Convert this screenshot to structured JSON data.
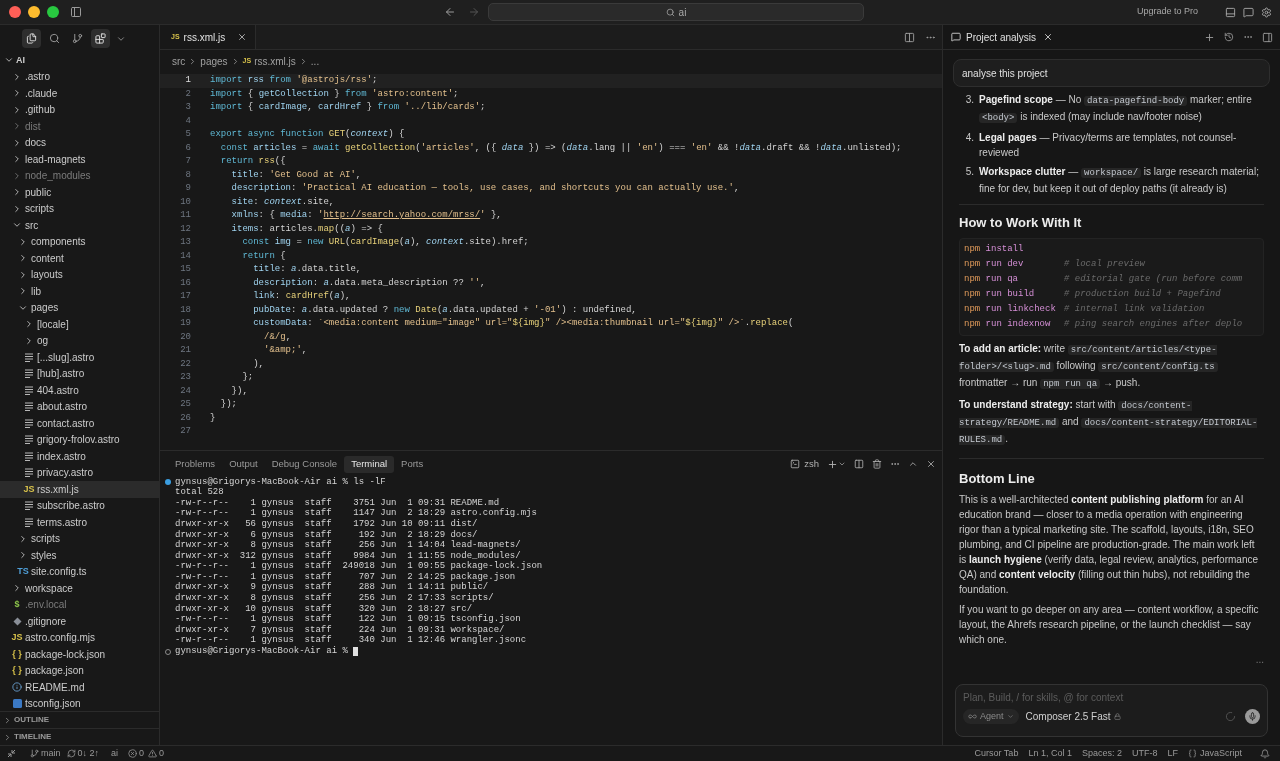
{
  "titlebar": {
    "search": "ai",
    "upgrade": "Upgrade to Pro"
  },
  "activity": [
    {
      "kind": "files",
      "selected": true
    },
    {
      "kind": "search",
      "selected": false
    },
    {
      "kind": "git",
      "selected": false
    },
    {
      "kind": "extensions",
      "selected": true
    }
  ],
  "sidebar": {
    "root": {
      "name": "AI",
      "expanded": true,
      "children": [
        {
          "name": ".astro",
          "kind": "folder",
          "expanded": false,
          "ignored": false,
          "selected": false
        },
        {
          "name": ".claude",
          "kind": "folder",
          "expanded": false,
          "ignored": false,
          "selected": false
        },
        {
          "name": ".github",
          "kind": "folder",
          "expanded": false,
          "ignored": false,
          "selected": false
        },
        {
          "name": "dist",
          "kind": "folder",
          "expanded": false,
          "ignored": true,
          "selected": false
        },
        {
          "name": "docs",
          "kind": "folder",
          "expanded": false,
          "ignored": false,
          "selected": false
        },
        {
          "name": "lead-magnets",
          "kind": "folder",
          "expanded": false,
          "ignored": false,
          "selected": false
        },
        {
          "name": "node_modules",
          "kind": "folder",
          "expanded": false,
          "ignored": true,
          "selected": false
        },
        {
          "name": "public",
          "kind": "folder",
          "expanded": false,
          "ignored": false,
          "selected": false
        },
        {
          "name": "scripts",
          "kind": "folder",
          "expanded": false,
          "ignored": false,
          "selected": false
        },
        {
          "name": "src",
          "kind": "folder",
          "expanded": true,
          "ignored": false,
          "selected": false,
          "children": [
            {
              "name": "components",
              "kind": "folder",
              "expanded": false,
              "ignored": false,
              "selected": false
            },
            {
              "name": "content",
              "kind": "folder",
              "expanded": false,
              "ignored": false,
              "selected": false
            },
            {
              "name": "layouts",
              "kind": "folder",
              "expanded": false,
              "ignored": false,
              "selected": false
            },
            {
              "name": "lib",
              "kind": "folder",
              "expanded": false,
              "ignored": false,
              "selected": false
            },
            {
              "name": "pages",
              "kind": "folder",
              "expanded": true,
              "ignored": false,
              "selected": false,
              "children": [
                {
                  "name": "[locale]",
                  "kind": "folder",
                  "expanded": false,
                  "ignored": false,
                  "selected": false
                },
                {
                  "name": "og",
                  "kind": "folder",
                  "expanded": false,
                  "ignored": false,
                  "selected": false
                },
                {
                  "name": "[...slug].astro",
                  "kind": "page",
                  "ignored": false,
                  "selected": false
                },
                {
                  "name": "[hub].astro",
                  "kind": "page",
                  "ignored": false,
                  "selected": false
                },
                {
                  "name": "404.astro",
                  "kind": "page",
                  "ignored": false,
                  "selected": false
                },
                {
                  "name": "about.astro",
                  "kind": "page",
                  "ignored": false,
                  "selected": false
                },
                {
                  "name": "contact.astro",
                  "kind": "page",
                  "ignored": false,
                  "selected": false
                },
                {
                  "name": "grigory-frolov.astro",
                  "kind": "page",
                  "ignored": false,
                  "selected": false
                },
                {
                  "name": "index.astro",
                  "kind": "page",
                  "ignored": false,
                  "selected": false
                },
                {
                  "name": "privacy.astro",
                  "kind": "page",
                  "ignored": false,
                  "selected": false
                },
                {
                  "name": "rss.xml.js",
                  "kind": "labeled",
                  "badge": "JS",
                  "color": "#d7c14a",
                  "ignored": false,
                  "selected": true
                },
                {
                  "name": "subscribe.astro",
                  "kind": "page",
                  "ignored": false,
                  "selected": false
                },
                {
                  "name": "terms.astro",
                  "kind": "page",
                  "ignored": false,
                  "selected": false
                }
              ]
            },
            {
              "name": "scripts",
              "kind": "folder",
              "expanded": false,
              "ignored": false,
              "selected": false
            },
            {
              "name": "styles",
              "kind": "folder",
              "expanded": false,
              "ignored": false,
              "selected": false
            },
            {
              "name": "site.config.ts",
              "kind": "labeled",
              "badge": "TS",
              "color": "#4f9fd8",
              "ignored": false,
              "selected": false
            }
          ]
        },
        {
          "name": "workspace",
          "kind": "folder",
          "expanded": false,
          "ignored": false,
          "selected": false
        },
        {
          "name": ".env.local",
          "kind": "labeled",
          "badge": "$",
          "color": "#8bc34a",
          "ignored": true,
          "selected": false
        },
        {
          "name": ".gitignore",
          "kind": "ignorefile",
          "ignored": false,
          "selected": false
        },
        {
          "name": "astro.config.mjs",
          "kind": "labeled",
          "badge": "JS",
          "color": "#d7c14a",
          "ignored": false,
          "selected": false
        },
        {
          "name": "package-lock.json",
          "kind": "labeled",
          "badge": "{ }",
          "color": "#d7c14a",
          "ignored": false,
          "selected": false
        },
        {
          "name": "package.json",
          "kind": "labeled",
          "badge": "{ }",
          "color": "#d7c14a",
          "ignored": false,
          "selected": false
        },
        {
          "name": "README.md",
          "kind": "readme",
          "ignored": false,
          "selected": false
        },
        {
          "name": "tsconfig.json",
          "kind": "config",
          "ignored": false,
          "selected": false
        }
      ]
    },
    "sections": [
      "OUTLINE",
      "TIMELINE"
    ]
  },
  "editor": {
    "tab": {
      "badge": "JS",
      "name": "rss.xml.js"
    },
    "breadcrumb": [
      "src",
      "pages",
      "rss.xml.js",
      "..."
    ],
    "breadcrumb_badge": "JS",
    "lines": [
      {
        "number": "1",
        "current": true,
        "tokens": [
          {
            "kind": "k",
            "text": "import "
          },
          {
            "kind": "p",
            "text": "rss "
          },
          {
            "kind": "k",
            "text": "from "
          },
          {
            "kind": "s",
            "text": "'@astrojs/rss'"
          },
          {
            "kind": "o",
            "text": ";"
          }
        ]
      },
      {
        "number": "2",
        "current": false,
        "tokens": [
          {
            "kind": "k",
            "text": "import "
          },
          {
            "kind": "o",
            "text": "{ "
          },
          {
            "kind": "p",
            "text": "getCollection "
          },
          {
            "kind": "o",
            "text": "} "
          },
          {
            "kind": "k",
            "text": "from "
          },
          {
            "kind": "s",
            "text": "'astro:content'"
          },
          {
            "kind": "o",
            "text": ";"
          }
        ]
      },
      {
        "number": "3",
        "current": false,
        "tokens": [
          {
            "kind": "k",
            "text": "import "
          },
          {
            "kind": "o",
            "text": "{ "
          },
          {
            "kind": "p",
            "text": "cardImage"
          },
          {
            "kind": "o",
            "text": ", "
          },
          {
            "kind": "p",
            "text": "cardHref "
          },
          {
            "kind": "o",
            "text": "} "
          },
          {
            "kind": "k",
            "text": "from "
          },
          {
            "kind": "s",
            "text": "'../lib/cards'"
          },
          {
            "kind": "o",
            "text": ";"
          }
        ]
      },
      {
        "number": "4",
        "current": false
      },
      {
        "number": "5",
        "current": false,
        "tokens": [
          {
            "kind": "k",
            "text": "export async function "
          },
          {
            "kind": "f",
            "text": "GET"
          },
          {
            "kind": "o",
            "text": "("
          },
          {
            "kind": "v",
            "text": "context"
          },
          {
            "kind": "o",
            "text": ") {"
          }
        ]
      },
      {
        "number": "6",
        "current": false,
        "tokens": [
          {
            "kind": "k",
            "text": "  const "
          },
          {
            "kind": "p",
            "text": "articles "
          },
          {
            "kind": "o",
            "text": "= "
          },
          {
            "kind": "k",
            "text": "await "
          },
          {
            "kind": "f",
            "text": "getCollection"
          },
          {
            "kind": "o",
            "text": "("
          },
          {
            "kind": "s",
            "text": "'articles'"
          },
          {
            "kind": "o",
            "text": ", ({ "
          },
          {
            "kind": "v",
            "text": "data"
          },
          {
            "kind": "o",
            "text": " }) => ("
          },
          {
            "kind": "v",
            "text": "data"
          },
          {
            "kind": "o",
            "text": ".lang || "
          },
          {
            "kind": "s",
            "text": "'en'"
          },
          {
            "kind": "o",
            "text": ") === "
          },
          {
            "kind": "s",
            "text": "'en'"
          },
          {
            "kind": "o",
            "text": " && !"
          },
          {
            "kind": "v",
            "text": "data"
          },
          {
            "kind": "o",
            "text": ".draft && !"
          },
          {
            "kind": "v",
            "text": "data"
          },
          {
            "kind": "o",
            "text": ".unlisted);"
          }
        ]
      },
      {
        "number": "7",
        "current": false,
        "tokens": [
          {
            "kind": "k",
            "text": "  return "
          },
          {
            "kind": "f",
            "text": "rss"
          },
          {
            "kind": "o",
            "text": "({"
          }
        ]
      },
      {
        "number": "8",
        "current": false,
        "tokens": [
          {
            "kind": "p",
            "text": "    title"
          },
          {
            "kind": "o",
            "text": ": "
          },
          {
            "kind": "s",
            "text": "'Get Good at AI'"
          },
          {
            "kind": "o",
            "text": ","
          }
        ]
      },
      {
        "number": "9",
        "current": false,
        "tokens": [
          {
            "kind": "p",
            "text": "    description"
          },
          {
            "kind": "o",
            "text": ": "
          },
          {
            "kind": "s",
            "text": "'Practical AI education — tools, use cases, and shortcuts you can actually use.'"
          },
          {
            "kind": "o",
            "text": ","
          }
        ]
      },
      {
        "number": "10",
        "current": false,
        "tokens": [
          {
            "kind": "p",
            "text": "    site"
          },
          {
            "kind": "o",
            "text": ": "
          },
          {
            "kind": "v",
            "text": "context"
          },
          {
            "kind": "o",
            "text": ".site,"
          }
        ]
      },
      {
        "number": "11",
        "current": false,
        "tokens": [
          {
            "kind": "p",
            "text": "    xmlns"
          },
          {
            "kind": "o",
            "text": ": { "
          },
          {
            "kind": "p",
            "text": "media"
          },
          {
            "kind": "o",
            "text": ": "
          },
          {
            "kind": "s",
            "text": "'"
          },
          {
            "kind": "u",
            "text": "http://search.yahoo.com/mrss/"
          },
          {
            "kind": "s",
            "text": "'"
          },
          {
            "kind": "o",
            "text": " },"
          }
        ]
      },
      {
        "number": "12",
        "current": false,
        "tokens": [
          {
            "kind": "p",
            "text": "    items"
          },
          {
            "kind": "o",
            "text": ": articles."
          },
          {
            "kind": "f",
            "text": "map"
          },
          {
            "kind": "o",
            "text": "(("
          },
          {
            "kind": "v",
            "text": "a"
          },
          {
            "kind": "o",
            "text": ") => {"
          }
        ]
      },
      {
        "number": "13",
        "current": false,
        "tokens": [
          {
            "kind": "k",
            "text": "      const "
          },
          {
            "kind": "p",
            "text": "img "
          },
          {
            "kind": "o",
            "text": "= "
          },
          {
            "kind": "k",
            "text": "new "
          },
          {
            "kind": "f",
            "text": "URL"
          },
          {
            "kind": "o",
            "text": "("
          },
          {
            "kind": "f",
            "text": "cardImage"
          },
          {
            "kind": "o",
            "text": "("
          },
          {
            "kind": "v",
            "text": "a"
          },
          {
            "kind": "o",
            "text": "), "
          },
          {
            "kind": "v",
            "text": "context"
          },
          {
            "kind": "o",
            "text": ".site).href;"
          }
        ]
      },
      {
        "number": "14",
        "current": false,
        "tokens": [
          {
            "kind": "k",
            "text": "      return "
          },
          {
            "kind": "o",
            "text": "{"
          }
        ]
      },
      {
        "number": "15",
        "current": false,
        "tokens": [
          {
            "kind": "p",
            "text": "        title"
          },
          {
            "kind": "o",
            "text": ": "
          },
          {
            "kind": "v",
            "text": "a"
          },
          {
            "kind": "o",
            "text": ".data.title,"
          }
        ]
      },
      {
        "number": "16",
        "current": false,
        "tokens": [
          {
            "kind": "p",
            "text": "        description"
          },
          {
            "kind": "o",
            "text": ": "
          },
          {
            "kind": "v",
            "text": "a"
          },
          {
            "kind": "o",
            "text": ".data.meta_description ?? "
          },
          {
            "kind": "s",
            "text": "''"
          },
          {
            "kind": "o",
            "text": ","
          }
        ]
      },
      {
        "number": "17",
        "current": false,
        "tokens": [
          {
            "kind": "p",
            "text": "        link"
          },
          {
            "kind": "o",
            "text": ": "
          },
          {
            "kind": "f",
            "text": "cardHref"
          },
          {
            "kind": "o",
            "text": "("
          },
          {
            "kind": "v",
            "text": "a"
          },
          {
            "kind": "o",
            "text": "),"
          }
        ]
      },
      {
        "number": "18",
        "current": false,
        "tokens": [
          {
            "kind": "p",
            "text": "        pubDate"
          },
          {
            "kind": "o",
            "text": ": "
          },
          {
            "kind": "v",
            "text": "a"
          },
          {
            "kind": "o",
            "text": ".data.updated ? "
          },
          {
            "kind": "k",
            "text": "new "
          },
          {
            "kind": "f",
            "text": "Date"
          },
          {
            "kind": "o",
            "text": "("
          },
          {
            "kind": "v",
            "text": "a"
          },
          {
            "kind": "o",
            "text": ".data.updated + "
          },
          {
            "kind": "s",
            "text": "'-01'"
          },
          {
            "kind": "o",
            "text": ") : undefined,"
          }
        ]
      },
      {
        "number": "19",
        "current": false,
        "tokens": [
          {
            "kind": "p",
            "text": "        customData"
          },
          {
            "kind": "o",
            "text": ": "
          },
          {
            "kind": "s",
            "text": "`<media:content medium=\"image\" url=\""
          },
          {
            "kind": "f",
            "text": "${img}"
          },
          {
            "kind": "s",
            "text": "\" /><media:thumbnail url=\""
          },
          {
            "kind": "f",
            "text": "${img}"
          },
          {
            "kind": "s",
            "text": "\" />`"
          },
          {
            "kind": "o",
            "text": "."
          },
          {
            "kind": "f",
            "text": "replace"
          },
          {
            "kind": "o",
            "text": "("
          }
        ]
      },
      {
        "number": "20",
        "current": false,
        "tokens": [
          {
            "kind": "s",
            "text": "          /&/g"
          },
          {
            "kind": "o",
            "text": ","
          }
        ]
      },
      {
        "number": "21",
        "current": false,
        "tokens": [
          {
            "kind": "s",
            "text": "          '&amp;'"
          },
          {
            "kind": "o",
            "text": ","
          }
        ]
      },
      {
        "number": "22",
        "current": false,
        "tokens": [
          {
            "kind": "o",
            "text": "        ),"
          }
        ]
      },
      {
        "number": "23",
        "current": false,
        "tokens": [
          {
            "kind": "o",
            "text": "      };"
          }
        ]
      },
      {
        "number": "24",
        "current": false,
        "tokens": [
          {
            "kind": "o",
            "text": "    }),"
          }
        ]
      },
      {
        "number": "25",
        "current": false,
        "tokens": [
          {
            "kind": "o",
            "text": "  });"
          }
        ]
      },
      {
        "number": "26",
        "current": false,
        "tokens": [
          {
            "kind": "o",
            "text": "}"
          }
        ]
      },
      {
        "number": "27",
        "current": false
      }
    ]
  },
  "panel": {
    "tabs": [
      {
        "label": "Problems",
        "selected": false
      },
      {
        "label": "Output",
        "selected": false
      },
      {
        "label": "Debug Console",
        "selected": false
      },
      {
        "label": "Terminal",
        "selected": true
      },
      {
        "label": "Ports",
        "selected": false
      }
    ],
    "shell": "zsh",
    "lines": [
      {
        "kind": "command",
        "text": "gynsus@Grigorys-MacBook-Air ai % ls -lF"
      },
      {
        "kind": "output",
        "text": "total 528"
      },
      {
        "kind": "output",
        "text": "-rw-r--r--    1 gynsus  staff    3751 Jun  1 09:31 README.md"
      },
      {
        "kind": "output",
        "text": "-rw-r--r--    1 gynsus  staff    1147 Jun  2 18:29 astro.config.mjs"
      },
      {
        "kind": "output",
        "text": "drwxr-xr-x   56 gynsus  staff    1792 Jun 10 09:11 dist/"
      },
      {
        "kind": "output",
        "text": "drwxr-xr-x    6 gynsus  staff     192 Jun  2 18:29 docs/"
      },
      {
        "kind": "output",
        "text": "drwxr-xr-x    8 gynsus  staff     256 Jun  1 14:04 lead-magnets/"
      },
      {
        "kind": "output",
        "text": "drwxr-xr-x  312 gynsus  staff    9984 Jun  1 11:55 node_modules/"
      },
      {
        "kind": "output",
        "text": "-rw-r--r--    1 gynsus  staff  249018 Jun  1 09:55 package-lock.json"
      },
      {
        "kind": "output",
        "text": "-rw-r--r--    1 gynsus  staff     707 Jun  2 14:25 package.json"
      },
      {
        "kind": "output",
        "text": "drwxr-xr-x    9 gynsus  staff     288 Jun  1 14:11 public/"
      },
      {
        "kind": "output",
        "text": "drwxr-xr-x    8 gynsus  staff     256 Jun  2 17:33 scripts/"
      },
      {
        "kind": "output",
        "text": "drwxr-xr-x   10 gynsus  staff     320 Jun  2 18:27 src/"
      },
      {
        "kind": "output",
        "text": "-rw-r--r--    1 gynsus  staff     122 Jun  1 09:15 tsconfig.json"
      },
      {
        "kind": "output",
        "text": "drwxr-xr-x    7 gynsus  staff     224 Jun  1 09:31 workspace/"
      },
      {
        "kind": "output",
        "text": "-rw-r--r--    1 gynsus  staff     340 Jun  1 12:46 wrangler.jsonc"
      },
      {
        "kind": "prompt",
        "text": "gynsus@Grigorys-MacBook-Air ai %"
      }
    ]
  },
  "chat": {
    "title": "Project analysis",
    "user_message": "analyse this project",
    "list": [
      {
        "number": "3.",
        "segments": [
          {
            "kind": "b",
            "text": "Pagefind scope"
          },
          {
            "kind": "t",
            "text": " — No "
          },
          {
            "kind": "c",
            "text": "data-pagefind-body"
          },
          {
            "kind": "t",
            "text": " marker; entire "
          },
          {
            "kind": "c",
            "text": "<body>"
          },
          {
            "kind": "t",
            "text": " is indexed (may include nav/footer noise)"
          }
        ]
      },
      {
        "number": "4.",
        "segments": [
          {
            "kind": "b",
            "text": "Legal pages"
          },
          {
            "kind": "t",
            "text": " — Privacy/terms are templates, not counsel-reviewed"
          }
        ]
      },
      {
        "number": "5.",
        "segments": [
          {
            "kind": "b",
            "text": "Workspace clutter"
          },
          {
            "kind": "t",
            "text": " — "
          },
          {
            "kind": "c",
            "text": "workspace/"
          },
          {
            "kind": "t",
            "text": " is large research material; fine for dev, but keep it out of deploy paths (it already is)"
          }
        ]
      }
    ],
    "heading_1": "How to Work With It",
    "commands": [
      {
        "cmd": "npm",
        "args": "install"
      },
      {
        "cmd": "npm",
        "args": "run dev",
        "comment": "# local preview"
      },
      {
        "cmd": "npm",
        "args": "run qa",
        "comment": "# editorial gate (run before comm"
      },
      {
        "cmd": "npm",
        "args": "run build",
        "comment": "# production build + Pagefind"
      },
      {
        "cmd": "npm",
        "args": "run linkcheck",
        "comment": "# internal link validation"
      },
      {
        "cmd": "npm",
        "args": "run indexnow",
        "comment": "# ping search engines after deplo"
      }
    ],
    "notes": [
      [
        {
          "kind": "b",
          "text": "To add an article:"
        },
        {
          "kind": "t",
          "text": " write "
        },
        {
          "kind": "c",
          "text": "src/content/articles/<type-folder>/<slug>.md"
        },
        {
          "kind": "t",
          "text": " following "
        },
        {
          "kind": "c",
          "text": "src/content/config.ts"
        },
        {
          "kind": "t",
          "text": " frontmatter → run "
        },
        {
          "kind": "c",
          "text": "npm run qa"
        },
        {
          "kind": "t",
          "text": " → push."
        }
      ],
      [
        {
          "kind": "b",
          "text": "To understand strategy:"
        },
        {
          "kind": "t",
          "text": " start with "
        },
        {
          "kind": "c",
          "text": "docs/content-strategy/README.md"
        },
        {
          "kind": "t",
          "text": " and "
        },
        {
          "kind": "c",
          "text": "docs/content-strategy/EDITORIAL-RULES.md"
        },
        {
          "kind": "t",
          "text": "."
        }
      ]
    ],
    "heading_2": "Bottom Line",
    "summary": [
      [
        {
          "kind": "t",
          "text": "This is a well-architected "
        },
        {
          "kind": "b",
          "text": "content publishing platform"
        },
        {
          "kind": "t",
          "text": " for an AI education brand — closer to a media operation with engineering rigor than a typical marketing site. The scaffold, layouts, i18n, SEO plumbing, and CI pipeline are production-grade. The main work left is "
        },
        {
          "kind": "b",
          "text": "launch hygiene"
        },
        {
          "kind": "t",
          "text": " (verify data, legal review, analytics, performance QA) and "
        },
        {
          "kind": "b",
          "text": "content velocity"
        },
        {
          "kind": "t",
          "text": " (filling out thin hubs), not rebuilding the foundation."
        }
      ],
      [
        {
          "kind": "t",
          "text": "If you want to go deeper on any area — content workflow, a specific layout, the Ahrefs research pipeline, or the launch checklist — say which one."
        }
      ]
    ],
    "more": "...",
    "input_placeholder": "Plan, Build, / for skills, @ for context",
    "mode": "Agent",
    "model": "Composer 2.5 Fast"
  },
  "status_bar": {
    "branch": "main",
    "sync": "0↓ 2↑",
    "folder": "ai",
    "errors": "0",
    "warnings": "0",
    "right": [
      "Cursor Tab",
      "Ln 1, Col 1",
      "Spaces: 2",
      "UTF-8",
      "LF"
    ],
    "language": "JavaScript"
  }
}
